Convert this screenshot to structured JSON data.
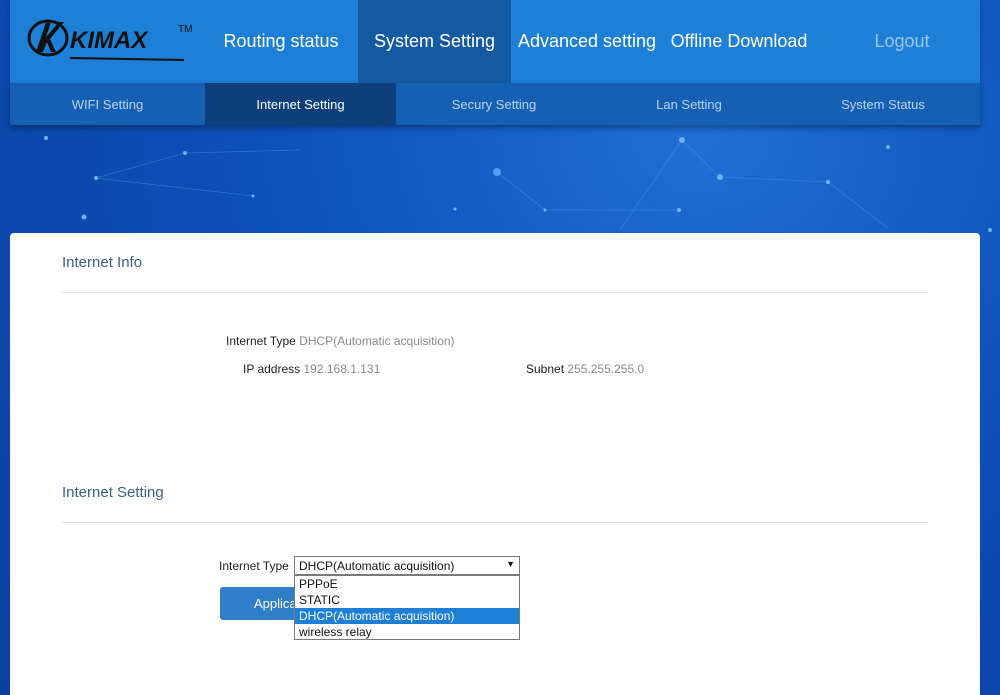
{
  "brand": {
    "logo_text": "KIMAX",
    "trademark": "TM"
  },
  "nav": {
    "items": [
      {
        "label": "Routing status"
      },
      {
        "label": "System Setting"
      },
      {
        "label": "Advanced setting"
      },
      {
        "label": "Offline Download"
      },
      {
        "label": "Logout"
      }
    ],
    "active_index": 1
  },
  "subnav": {
    "items": [
      {
        "label": "WIFI Setting"
      },
      {
        "label": "Internet Setting"
      },
      {
        "label": "Secury Setting"
      },
      {
        "label": "Lan Setting"
      },
      {
        "label": "System Status"
      }
    ],
    "active_index": 1
  },
  "internet_info": {
    "title": "Internet Info",
    "type_label": "Internet Type",
    "type_value": "DHCP(Automatic acquisition)",
    "ip_label": "IP address",
    "ip_value": "192.168.1.131",
    "subnet_label": "Subnet",
    "subnet_value": "255.255.255.0"
  },
  "internet_setting": {
    "title": "Internet Setting",
    "type_label": "Internet Type",
    "selected_value": "DHCP(Automatic acquisition)",
    "options": [
      "PPPoE",
      "STATIC",
      "DHCP(Automatic acquisition)",
      "wireless relay"
    ],
    "selected_index": 2,
    "apply_label": "Applica"
  },
  "colors": {
    "nav_bg": "#1e7fd6",
    "nav_active": "#145aa3",
    "subnav_bg": "#1660b4",
    "subnav_active": "#0e3f7a",
    "section_title": "#3a5f85",
    "button": "#2f7ec8"
  }
}
